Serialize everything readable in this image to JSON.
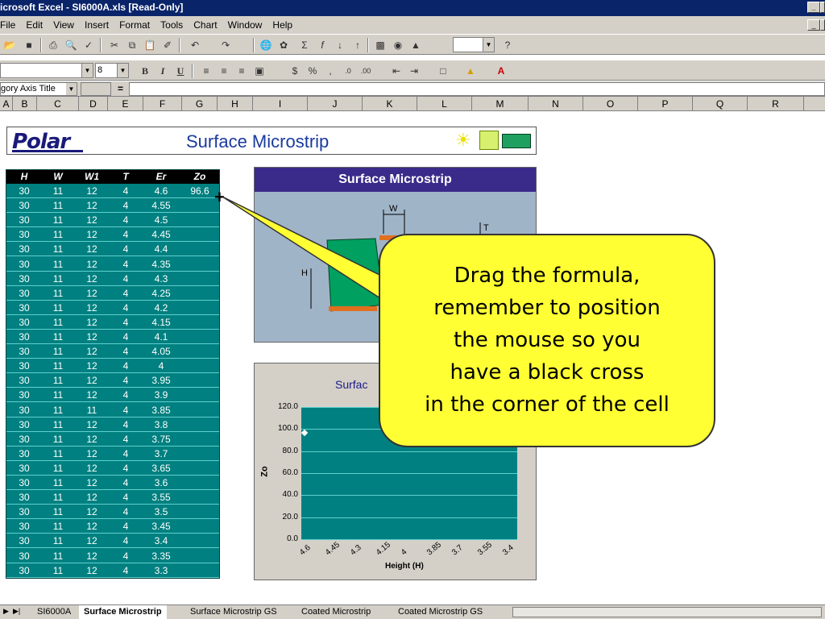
{
  "window": {
    "title": "icrosoft Excel - SI6000A.xls  [Read-Only]"
  },
  "menu": [
    "File",
    "Edit",
    "View",
    "Insert",
    "Format",
    "Tools",
    "Chart",
    "Window",
    "Help"
  ],
  "format_toolbar": {
    "font_size": "8",
    "bold": "B",
    "italic": "I",
    "underline": "U",
    "percent": "%",
    "comma": ","
  },
  "formula_bar": {
    "name_box": "gory Axis Title",
    "equals": "="
  },
  "columns": [
    "A",
    "B",
    "C",
    "D",
    "E",
    "F",
    "G",
    "H",
    "I",
    "J",
    "K",
    "L",
    "M",
    "N",
    "O",
    "P",
    "Q",
    "R"
  ],
  "banner": {
    "logo": "Polar",
    "title": "Surface Microstrip"
  },
  "table": {
    "headers": [
      "H",
      "W",
      "W1",
      "T",
      "Er",
      "Zo"
    ],
    "rows": [
      [
        "30",
        "11",
        "12",
        "4",
        "4.6",
        "96.6"
      ],
      [
        "30",
        "11",
        "12",
        "4",
        "4.55",
        ""
      ],
      [
        "30",
        "11",
        "12",
        "4",
        "4.5",
        ""
      ],
      [
        "30",
        "11",
        "12",
        "4",
        "4.45",
        ""
      ],
      [
        "30",
        "11",
        "12",
        "4",
        "4.4",
        ""
      ],
      [
        "30",
        "11",
        "12",
        "4",
        "4.35",
        ""
      ],
      [
        "30",
        "11",
        "12",
        "4",
        "4.3",
        ""
      ],
      [
        "30",
        "11",
        "12",
        "4",
        "4.25",
        ""
      ],
      [
        "30",
        "11",
        "12",
        "4",
        "4.2",
        ""
      ],
      [
        "30",
        "11",
        "12",
        "4",
        "4.15",
        ""
      ],
      [
        "30",
        "11",
        "12",
        "4",
        "4.1",
        ""
      ],
      [
        "30",
        "11",
        "12",
        "4",
        "4.05",
        ""
      ],
      [
        "30",
        "11",
        "12",
        "4",
        "4",
        ""
      ],
      [
        "30",
        "11",
        "12",
        "4",
        "3.95",
        ""
      ],
      [
        "30",
        "11",
        "12",
        "4",
        "3.9",
        ""
      ],
      [
        "30",
        "11",
        "11",
        "4",
        "3.85",
        ""
      ],
      [
        "30",
        "11",
        "12",
        "4",
        "3.8",
        ""
      ],
      [
        "30",
        "11",
        "12",
        "4",
        "3.75",
        ""
      ],
      [
        "30",
        "11",
        "12",
        "4",
        "3.7",
        ""
      ],
      [
        "30",
        "11",
        "12",
        "4",
        "3.65",
        ""
      ],
      [
        "30",
        "11",
        "12",
        "4",
        "3.6",
        ""
      ],
      [
        "30",
        "11",
        "12",
        "4",
        "3.55",
        ""
      ],
      [
        "30",
        "11",
        "12",
        "4",
        "3.5",
        ""
      ],
      [
        "30",
        "11",
        "12",
        "4",
        "3.45",
        ""
      ],
      [
        "30",
        "11",
        "12",
        "4",
        "3.4",
        ""
      ],
      [
        "30",
        "11",
        "12",
        "4",
        "3.35",
        ""
      ],
      [
        "30",
        "11",
        "12",
        "4",
        "3.3",
        ""
      ]
    ]
  },
  "diagram": {
    "title": "Surface Microstrip",
    "label_w": "W",
    "label_t": "T",
    "label_h": "H"
  },
  "chart_data": {
    "type": "scatter",
    "title": "Surfac",
    "ylabel": "Zo",
    "xlabel": "Height (H)",
    "yticks": [
      "0.0",
      "20.0",
      "40.0",
      "60.0",
      "80.0",
      "100.0",
      "120.0"
    ],
    "xticks": [
      "4.6",
      "4.45",
      "4.3",
      "4.15",
      "4",
      "3.85",
      "3.7",
      "3.55",
      "3.4"
    ],
    "ylim": [
      0,
      120
    ],
    "points": [
      {
        "x": "4.6",
        "y": 96.6
      }
    ]
  },
  "callout": {
    "lines": [
      "Drag the formula,",
      "remember to position",
      "the mouse so you",
      "have a black cross",
      "in the corner of the cell"
    ]
  },
  "sheet_tabs": [
    "SI6000A",
    "Surface Microstrip",
    "Surface Microstrip GS",
    "Coated Microstrip",
    "Coated Microstrip GS"
  ],
  "colors": {
    "teal": "#008080",
    "callout": "#ffff33",
    "title_bar": "#0a246a",
    "chrome": "#d4d0c8"
  }
}
